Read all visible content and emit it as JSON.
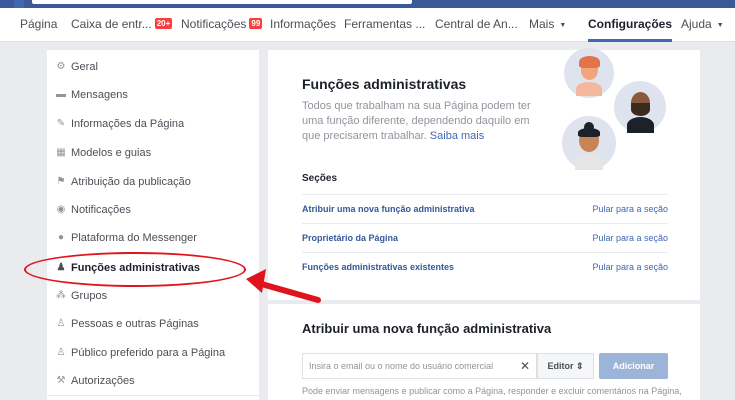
{
  "nav": {
    "items": [
      {
        "label": "Página"
      },
      {
        "label": "Caixa de entr...",
        "badge": "20+"
      },
      {
        "label": "Notificações",
        "badge": "99"
      },
      {
        "label": "Informações"
      },
      {
        "label": "Ferramentas ..."
      },
      {
        "label": "Central de An..."
      },
      {
        "label": "Mais"
      },
      {
        "label": "Configurações"
      },
      {
        "label": "Ajuda"
      }
    ]
  },
  "sidebar": {
    "items": [
      {
        "label": "Geral",
        "icon": "gear-icon"
      },
      {
        "label": "Mensagens",
        "icon": "message-icon"
      },
      {
        "label": "Informações da Página",
        "icon": "pencil-icon"
      },
      {
        "label": "Modelos e guias",
        "icon": "grid-icon"
      },
      {
        "label": "Atribuição da publicação",
        "icon": "flag-icon"
      },
      {
        "label": "Notificações",
        "icon": "globe-icon"
      },
      {
        "label": "Plataforma do Messenger",
        "icon": "messenger-icon"
      },
      {
        "label": "Funções administrativas",
        "icon": "person-icon"
      },
      {
        "label": "Grupos",
        "icon": "group-icon"
      },
      {
        "label": "Pessoas e outras Páginas",
        "icon": "person-plus-icon"
      },
      {
        "label": "Público preferido para a Página",
        "icon": "person-plus-icon"
      },
      {
        "label": "Autorizações",
        "icon": "wrench-icon"
      }
    ]
  },
  "main": {
    "title": "Funções administrativas",
    "description": "Todos que trabalham na sua Página podem ter uma função diferente, dependendo daquilo em que precisarem trabalhar.",
    "learn_more": "Saiba mais",
    "sections_title": "Seções",
    "sections": [
      {
        "label": "Atribuir uma nova função administrativa",
        "jump": "Pular para a seção"
      },
      {
        "label": "Proprietário da Página",
        "jump": "Pular para a seção"
      },
      {
        "label": "Funções administrativas existentes",
        "jump": "Pular para a seção"
      }
    ]
  },
  "assign": {
    "title": "Atribuir uma nova função administrativa",
    "input_placeholder": "Insira o email ou o nome do usuário comercial",
    "role_label": "Editor",
    "add_label": "Adicionar",
    "hint": "Pode enviar mensagens e publicar como a Página, responder e excluir comentários na Página,"
  },
  "colors": {
    "brand": "#3b5998",
    "link": "#4267b2",
    "annotation": "#e0141c"
  }
}
